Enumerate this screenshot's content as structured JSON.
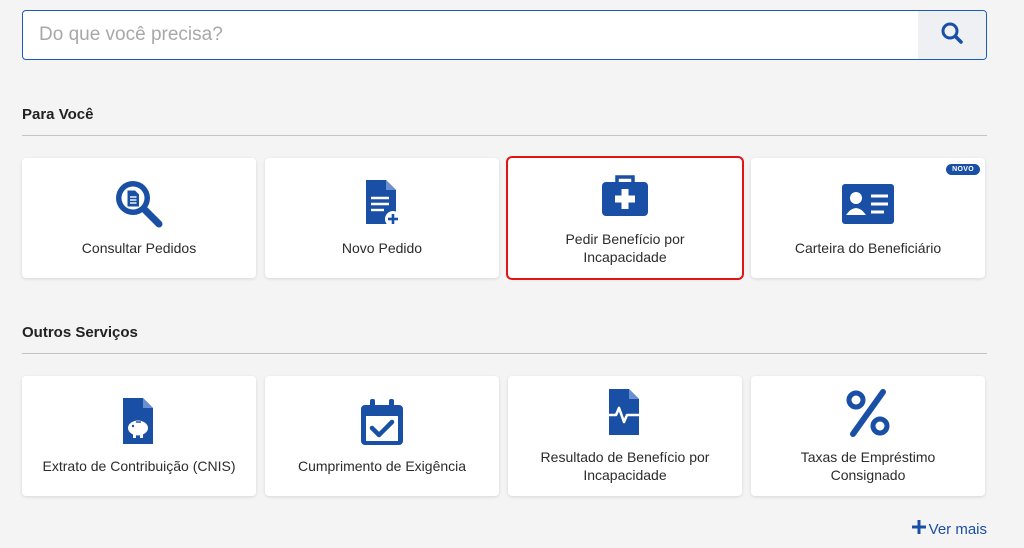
{
  "search": {
    "placeholder": "Do que você precisa?"
  },
  "sections": {
    "para_voce": {
      "title": "Para Você",
      "cards": [
        {
          "label": "Consultar Pedidos",
          "icon": "search-document-icon"
        },
        {
          "label": "Novo Pedido",
          "icon": "new-document-icon"
        },
        {
          "label": "Pedir Benefício por\nIncapacidade",
          "icon": "medical-kit-icon"
        },
        {
          "label": "Carteira do Beneficiário",
          "icon": "id-card-icon",
          "badge": "NOVO"
        }
      ]
    },
    "outros_servicos": {
      "title": "Outros Serviços",
      "cards": [
        {
          "label": "Extrato de Contribuição (CNIS)",
          "icon": "piggy-bank-document-icon"
        },
        {
          "label": "Cumprimento de Exigência",
          "icon": "calendar-check-icon"
        },
        {
          "label": "Resultado de Benefício por\nIncapacidade",
          "icon": "heartbeat-document-icon"
        },
        {
          "label": "Taxas de Empréstimo\nConsignado",
          "icon": "percent-icon"
        }
      ]
    }
  },
  "ver_mais": "Ver mais",
  "colors": {
    "brand_blue": "#1a4fa6",
    "highlight_red": "#e21414"
  }
}
